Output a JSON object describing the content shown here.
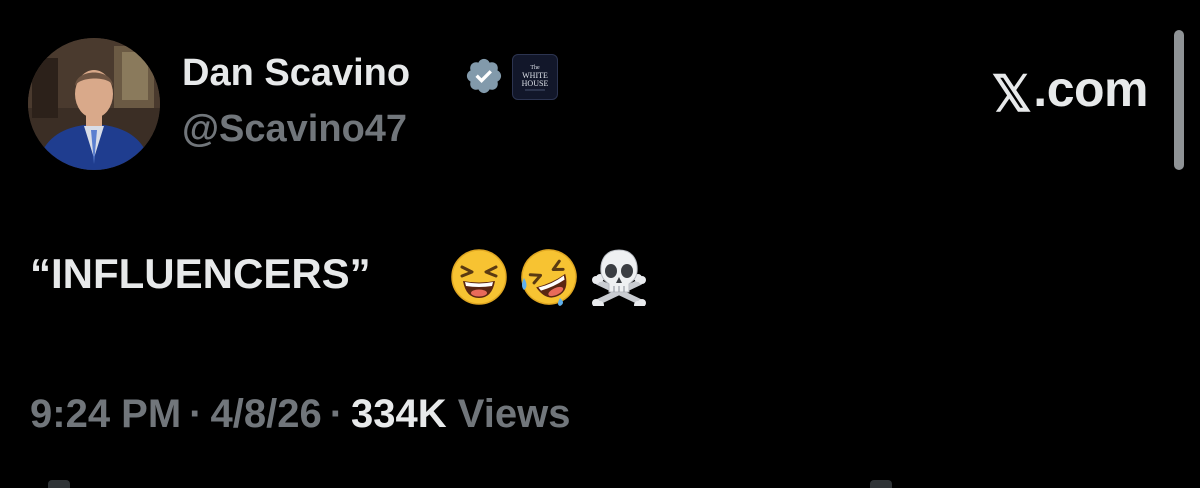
{
  "user": {
    "display_name": "Dan Scavino",
    "handle": "@Scavino47",
    "verified_icon": "verified-badge-icon",
    "org_badge_text_top": "The",
    "org_badge_text_mid": "WHITE",
    "org_badge_text_bot": "HOUSE"
  },
  "site": {
    "logo_glyph": "𝕏",
    "label": ".com"
  },
  "tweet": {
    "text": "“INFLUENCERS”",
    "emojis": [
      "laughing-face-emoji",
      "rofl-emoji",
      "skull-crossbones-emoji"
    ]
  },
  "meta": {
    "time": "9:24 PM",
    "date": "4/8/26",
    "views_count": "334K",
    "views_label": "Views",
    "separator": "·"
  },
  "colors": {
    "background": "#000000",
    "primary_text": "#e7e9ea",
    "secondary_text": "#71767b",
    "verified_blue": "#829aab"
  }
}
